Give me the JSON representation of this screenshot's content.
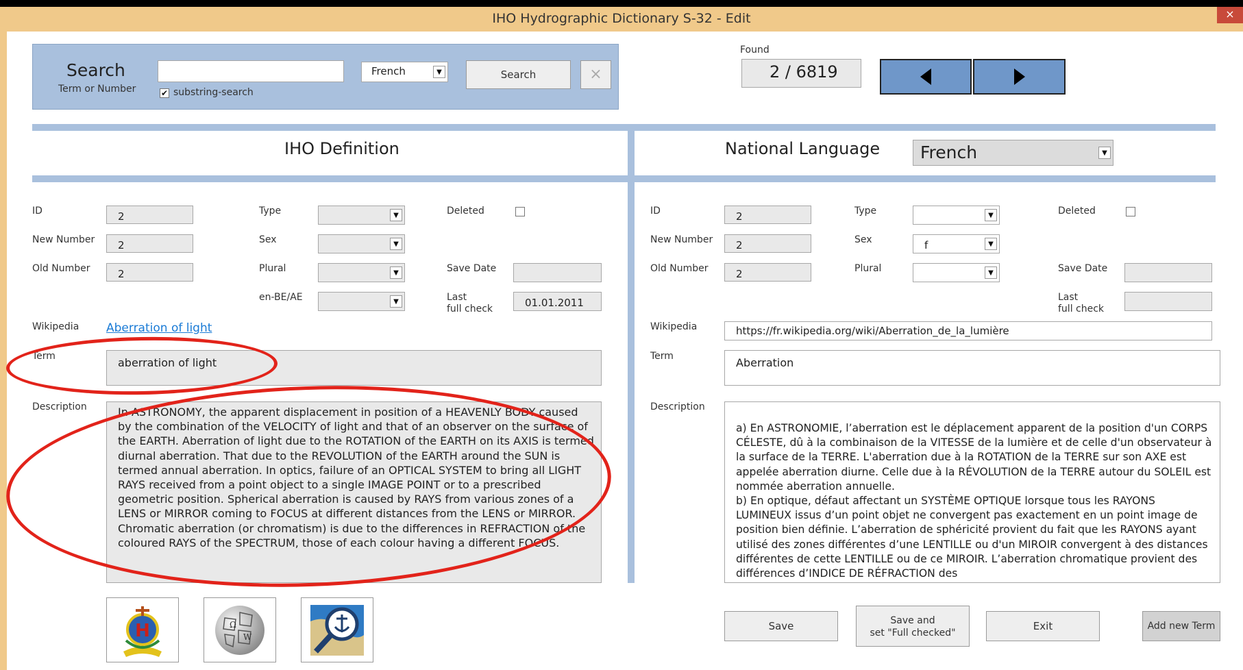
{
  "window": {
    "title": "IHO Hydrographic Dictionary S-32  -  Edit",
    "close_glyph": "×"
  },
  "search": {
    "heading": "Search",
    "subheading": "Term or Number",
    "input_value": "",
    "language_value": "French",
    "substring_label": "substring-search",
    "substring_checked": "✔",
    "search_button": "Search",
    "clear_button": "×"
  },
  "found": {
    "label": "Found",
    "value": "2 / 6819"
  },
  "iho": {
    "heading": "IHO Definition",
    "id_label": "ID",
    "id_value": "2",
    "new_number_label": "New Number",
    "new_number_value": "2",
    "old_number_label": "Old Number",
    "old_number_value": "2",
    "type_label": "Type",
    "type_value": "",
    "sex_label": "Sex",
    "sex_value": "",
    "plural_label": "Plural",
    "plural_value": "",
    "enbe_label": "en-BE/AE",
    "enbe_value": "",
    "deleted_label": "Deleted",
    "save_date_label": "Save Date",
    "save_date_value": "",
    "last_check_label": "Last\nfull check",
    "last_check_value": "01.01.2011",
    "wikipedia_label": "Wikipedia",
    "wikipedia_link": "Aberration of light",
    "term_label": "Term",
    "term_value": "aberration of light",
    "description_label": "Description",
    "description_value": "In ASTRONOMY, the apparent displacement in position of a HEAVENLY BODY caused by the combination of the VELOCITY of light and that of an observer on the surface of the EARTH. Aberration of light due to the ROTATION of the EARTH on its AXIS is termed diurnal aberration. That due to the REVOLUTION of the EARTH around the SUN is termed annual aberration. In optics, failure of an OPTICAL SYSTEM to bring all LIGHT RAYS received from a point object to a single IMAGE POINT or to a prescribed geometric position. Spherical aberration is caused by RAYS from various zones of a LENS or MIRROR coming to FOCUS at different distances from the LENS or MIRROR. Chromatic aberration (or chromatism) is due to the differences in REFRACTION of the coloured RAYS of the SPECTRUM, those of each colour having a different FOCUS."
  },
  "national": {
    "heading": "National Language",
    "language_value": "French",
    "id_label": "ID",
    "id_value": "2",
    "new_number_label": "New Number",
    "new_number_value": "2",
    "old_number_label": "Old Number",
    "old_number_value": "2",
    "type_label": "Type",
    "type_value": "",
    "sex_label": "Sex",
    "sex_value": "f",
    "plural_label": "Plural",
    "plural_value": "",
    "deleted_label": "Deleted",
    "save_date_label": "Save Date",
    "save_date_value": "",
    "last_check_label": "Last\nfull check",
    "last_check_value": "",
    "wikipedia_label": "Wikipedia",
    "wikipedia_value": "https://fr.wikipedia.org/wiki/Aberration_de_la_lumière",
    "term_label": "Term",
    "term_value": "Aberration",
    "description_label": "Description",
    "description_value": "a) En ASTRONOMIE, l’aberration est le déplacement apparent de la position d'un CORPS CÉLESTE, dû à la combinaison de la VITESSE de la lumière et de celle d'un observateur à la surface de la TERRE. L'aberration due à la ROTATION de la TERRE sur son AXE est appelée aberration diurne. Celle due à la RÉVOLUTION de la TERRE autour du SOLEIL est nommée aberration annuelle.\nb) En optique, défaut affectant un SYSTÈME OPTIQUE lorsque tous les RAYONS LUMINEUX issus d’un point objet ne convergent pas exactement en un point image de position bien définie. L’aberration de sphéricité provient du fait que les RAYONS ayant utilisé des zones différentes d’une LENTILLE ou d'un MIROIR convergent à des distances différentes de cette LENTILLE ou de ce  MIROIR. L’aberration chromatique provient des différences d’INDICE DE RÉFRACTION des"
  },
  "buttons": {
    "save": "Save",
    "save_full_checked": "Save and\nset \"Full checked\"",
    "exit": "Exit",
    "add_new_term": "Add new Term"
  },
  "colors": {
    "panel_blue": "#a9c0dd",
    "nav_blue": "#6f97c9",
    "link_blue": "#1a7bd6",
    "annotation_red": "#e2231a",
    "title_bar": "#f0c98a"
  }
}
